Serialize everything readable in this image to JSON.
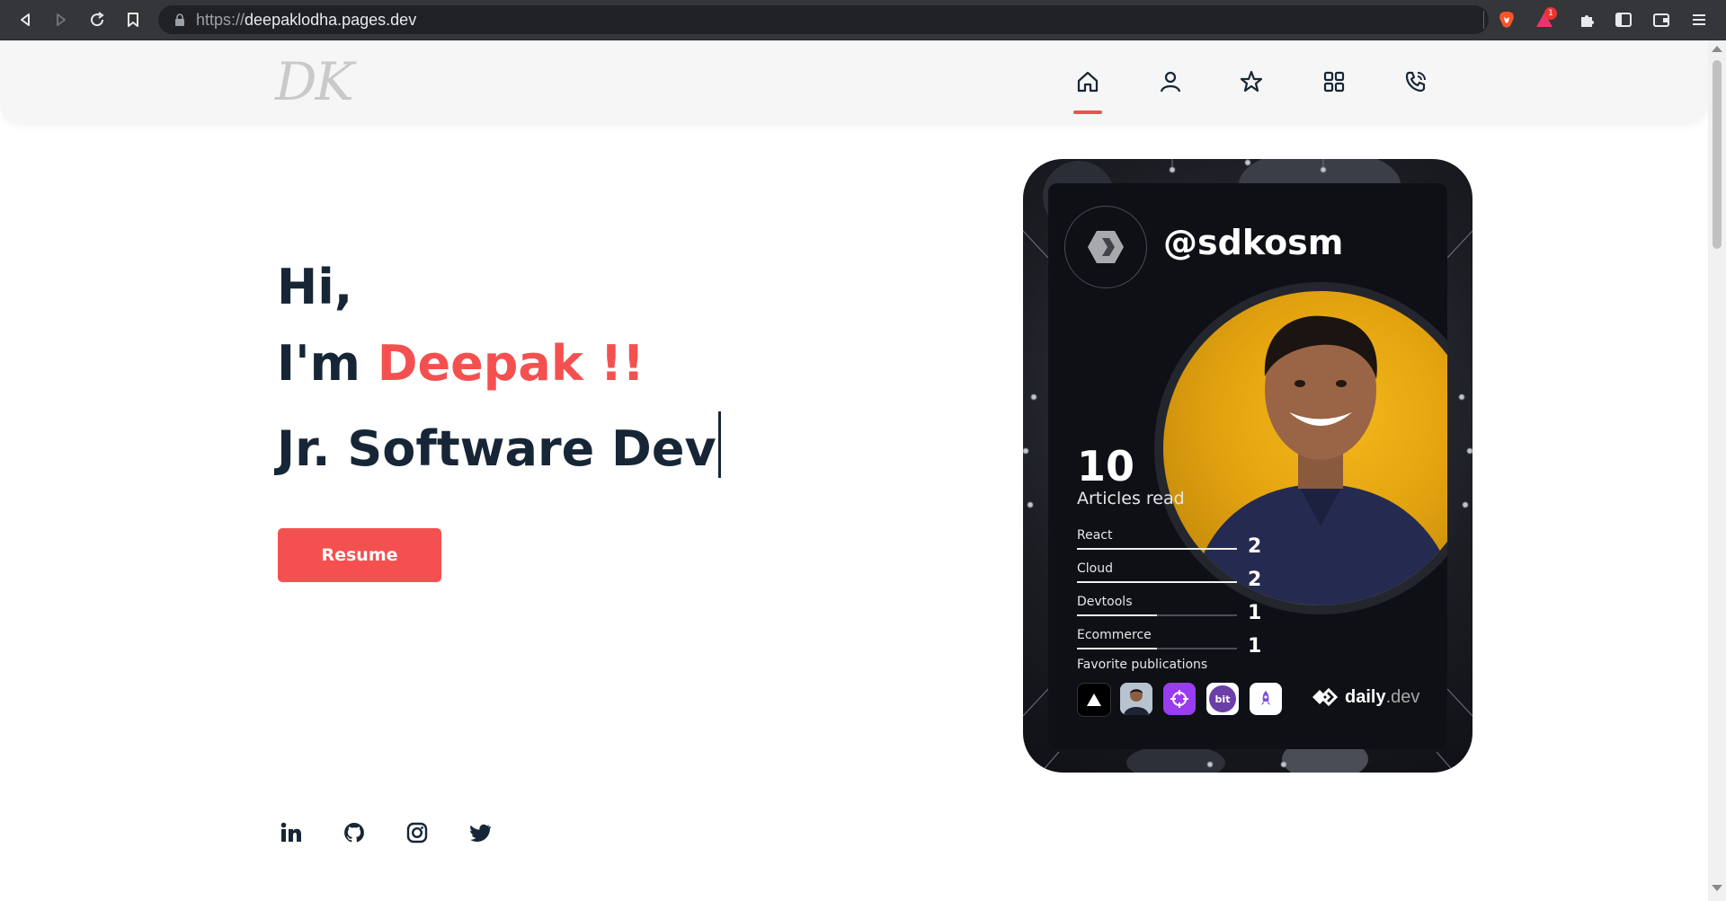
{
  "browser": {
    "url_scheme": "https://",
    "url_host": "deepaklodha.pages.dev",
    "extension_badge": "1"
  },
  "navbar": {
    "logo_text": "DK",
    "items": [
      {
        "icon": "home-icon",
        "active": true
      },
      {
        "icon": "user-icon",
        "active": false
      },
      {
        "icon": "star-icon",
        "active": false
      },
      {
        "icon": "grid-icon",
        "active": false
      },
      {
        "icon": "phone-icon",
        "active": false
      }
    ],
    "accent_color": "#f55050"
  },
  "hero": {
    "greeting": "Hi,",
    "intro_prefix": "I'm ",
    "name": "Deepak !!",
    "role": "Jr. Software Dev",
    "resume_label": "Resume"
  },
  "devcard": {
    "handle": "@sdkosm",
    "articles_count": "10",
    "articles_label": "Articles read",
    "tags": [
      {
        "name": "React",
        "count": "2",
        "fraction": 1.0
      },
      {
        "name": "Cloud",
        "count": "2",
        "fraction": 1.0
      },
      {
        "name": "Devtools",
        "count": "1",
        "fraction": 0.5
      },
      {
        "name": "Ecommerce",
        "count": "1",
        "fraction": 0.5
      }
    ],
    "favorites_label": "Favorite publications",
    "publications": [
      "vercel-icon",
      "author-avatar",
      "crosshair-icon",
      "bit-icon",
      "rocket-icon"
    ],
    "publication_bit_text": "bit",
    "brand_word": "daily",
    "brand_ext": ".dev"
  },
  "social": [
    "linkedin-icon",
    "github-icon",
    "instagram-icon",
    "twitter-icon"
  ],
  "colors": {
    "text_dark": "#172636",
    "accent": "#f55050",
    "card_bg": "#0e1015",
    "photo_bg": "#e3a310"
  }
}
